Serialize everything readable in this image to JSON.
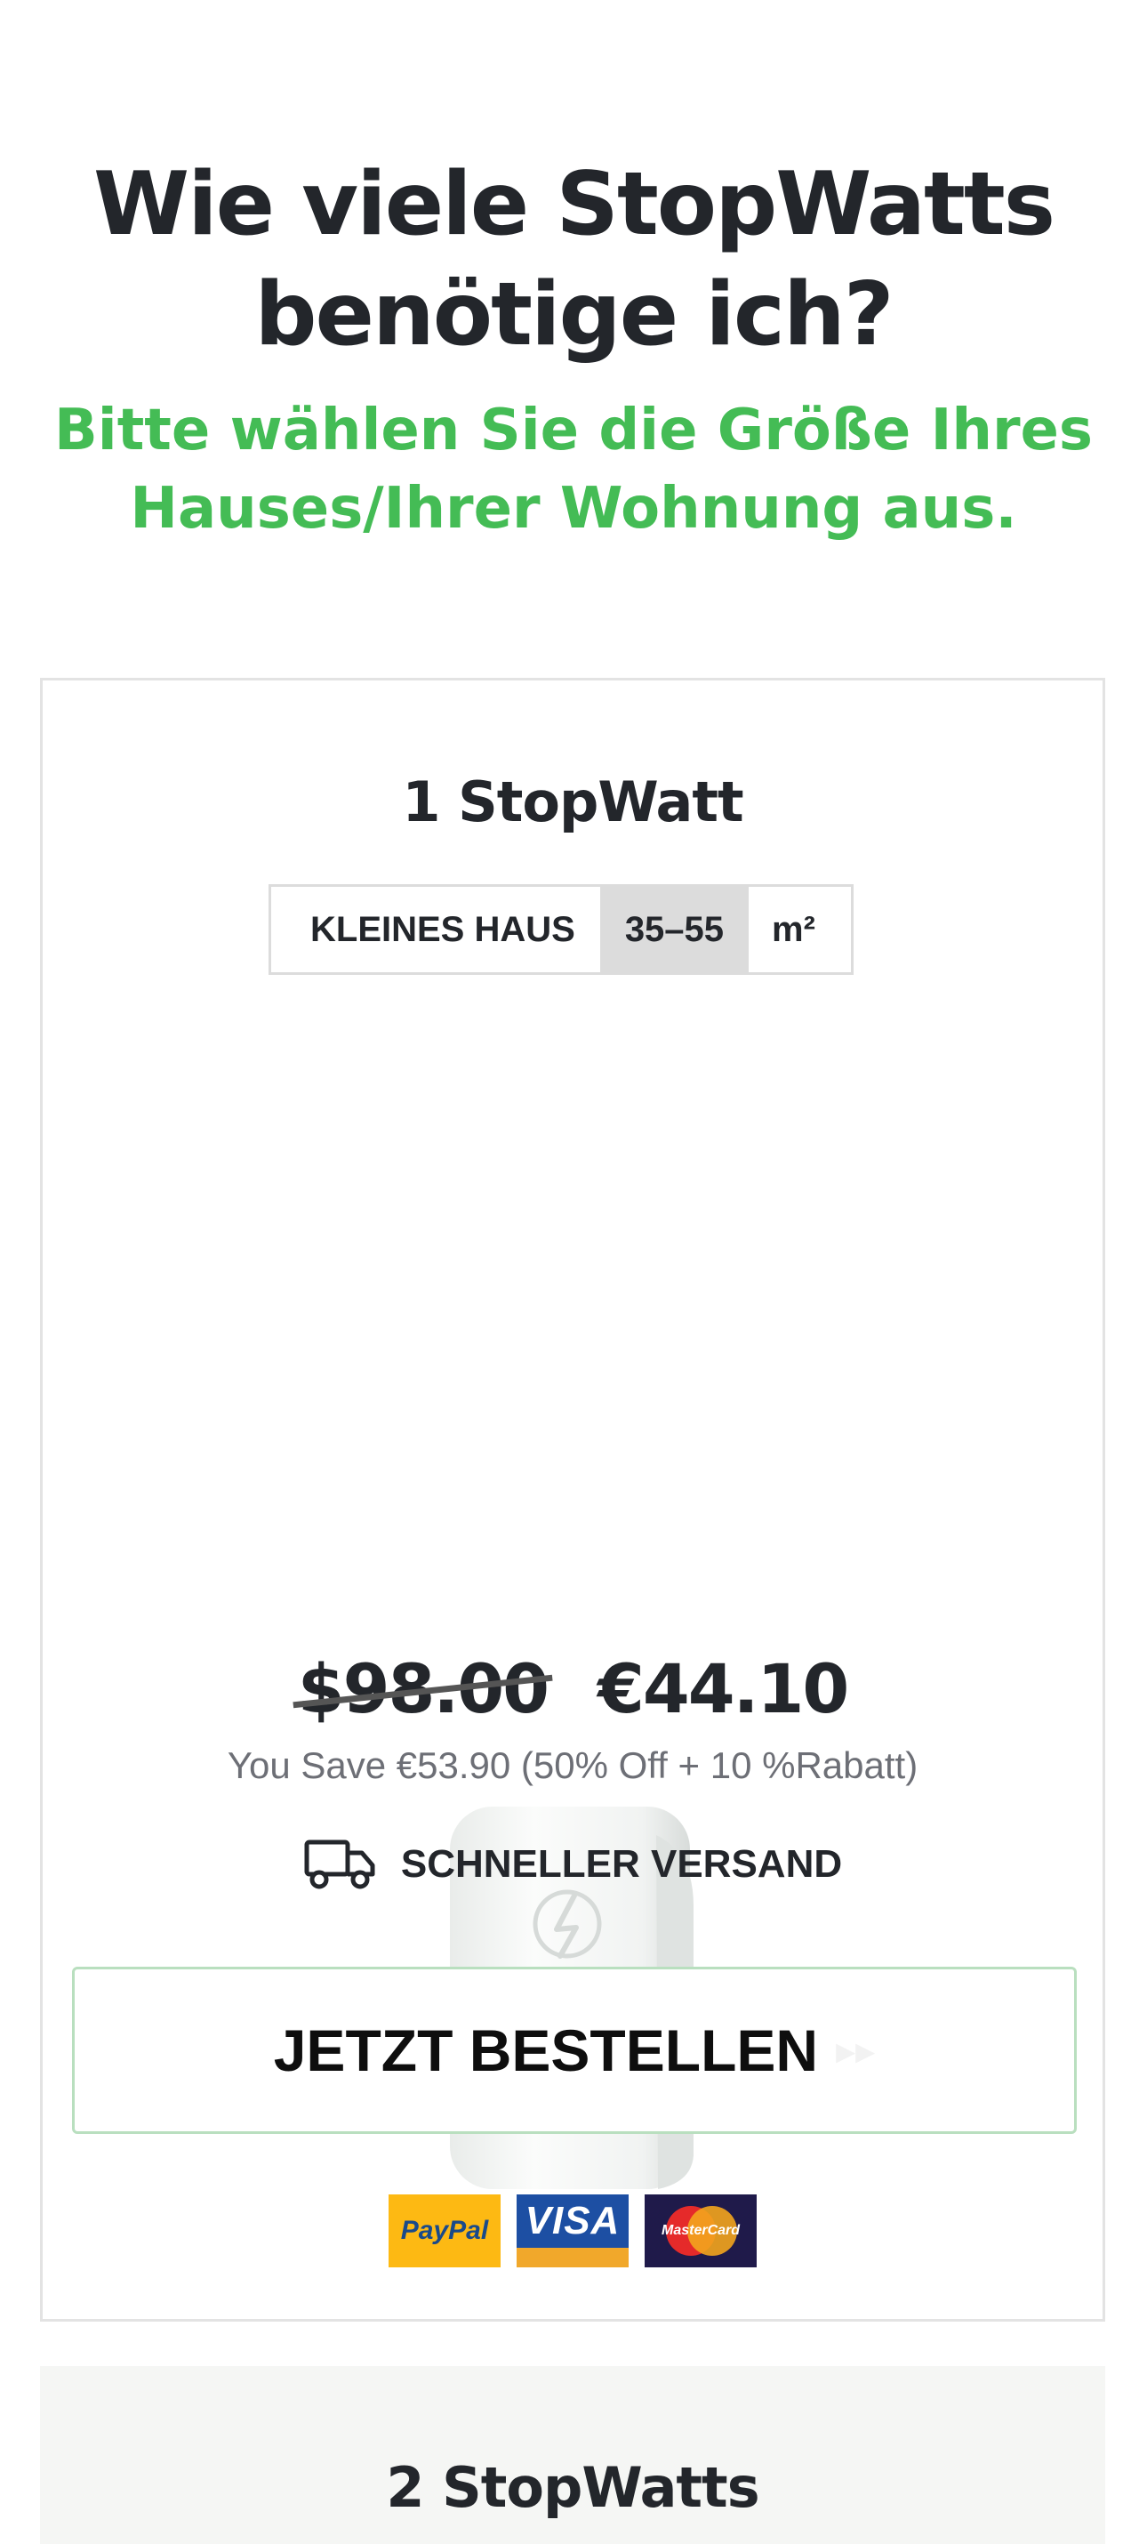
{
  "header": {
    "title": "Wie viele StopWatts benötige ich?",
    "subtitle": "Bitte wählen Sie die Größe Ihres Hauses/Ihrer Wohnung aus."
  },
  "offers": [
    {
      "title": "1 StopWatt",
      "size_label": "KLEINES HAUS",
      "size_range": "35–55",
      "size_unit": "m²",
      "old_price": "$98.00",
      "new_price": "€44.10",
      "savings": "You Save €53.90 (50% Off + 10 %Rabatt)",
      "shipping": "SCHNELLER VERSAND",
      "order_button": "JETZT BESTELLEN",
      "order_arrows": "▸▸",
      "payments": [
        "PayPal",
        "VISA",
        "MasterCard"
      ]
    },
    {
      "title": "2 StopWatts"
    }
  ],
  "colors": {
    "accent_green": "#44bc55",
    "text_dark": "#23262b",
    "muted_text": "#6d6f76",
    "button_border": "#b9dfbf"
  },
  "icons": {
    "shipping": "truck-icon",
    "order": "double-chevron-right-icon"
  }
}
